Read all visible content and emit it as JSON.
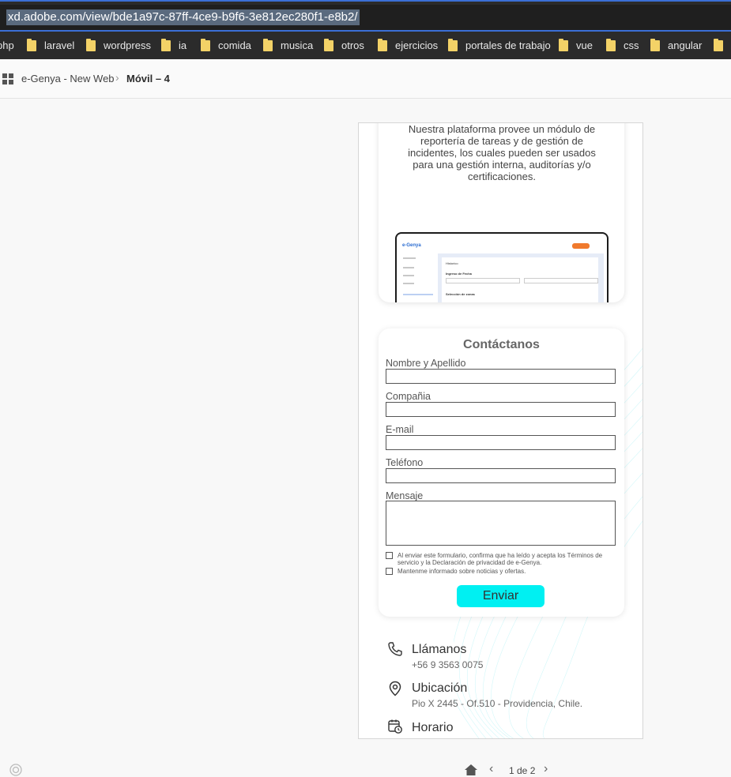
{
  "browser": {
    "url": "xd.adobe.com/view/bde1a97c-87ff-4ce9-b9f6-3e812ec280f1-e8b2/",
    "bookmarks": [
      "php",
      "laravel",
      "wordpress",
      "ia",
      "comida",
      "musica",
      "otros",
      "ejercicios",
      "portales de trabajo",
      "vue",
      "css",
      "angular"
    ]
  },
  "header": {
    "project": "e-Genya - New Web",
    "page": "Móvil – 4"
  },
  "artboard": {
    "description": "Nuestra plataforma provee un módulo de reportería de tareas y de gestión de incidentes, los cuales pueden ser usados para una gestión interna, auditorías y/o certificaciones.",
    "mockup": {
      "logo": "e-Genya",
      "items": [
        "Historico",
        "Ingreso de Fecha",
        "Selección de zonas"
      ]
    },
    "form": {
      "title": "Contáctanos",
      "fields": {
        "name_label": "Nombre y Apellido",
        "company_label": "Compañia",
        "email_label": "E-mail",
        "phone_label": "Teléfono",
        "message_label": "Mensaje"
      },
      "terms": "Al enviar este formulario, confirma que ha leído y acepta los Términos de servicio y la Declaración de privacidad de e-Genya.",
      "news": "Mantenme informado sobre noticias y ofertas.",
      "submit": "Enviar"
    },
    "contact": {
      "call_title": "Llámanos",
      "call_value": "+56 9 3563 0075",
      "location_title": "Ubicación",
      "location_value": "Pio X 2445 - Of.510 - Providencia, Chile.",
      "hours_title": "Horario"
    }
  },
  "pager": {
    "label": "1 de 2"
  },
  "colors": {
    "accent_blue": "#3b6fd6",
    "button_cyan": "#00f0f2",
    "folder_yellow": "#f3d267"
  },
  "icons": [
    "grid-icon",
    "folder-icon",
    "phone-icon",
    "location-pin-icon",
    "calendar-clock-icon",
    "home-icon",
    "chevron-left-icon",
    "chevron-right-icon",
    "creative-cloud-icon"
  ]
}
